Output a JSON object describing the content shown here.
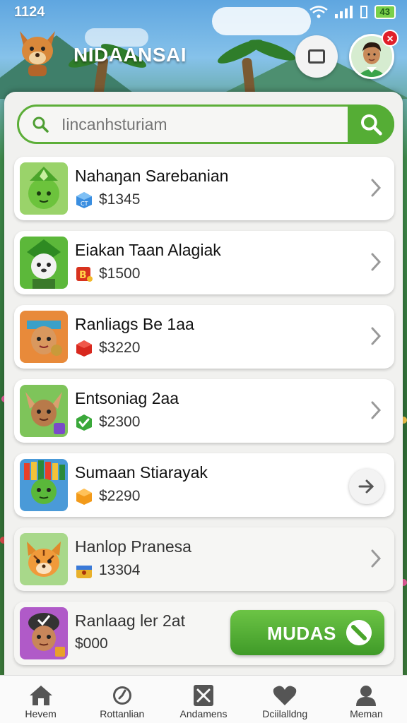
{
  "status_bar": {
    "time": "1124",
    "battery": "43"
  },
  "header": {
    "title": "NIDAANSAI",
    "notification_count": "×"
  },
  "search": {
    "placeholder": "Iincanhsturiam"
  },
  "items": [
    {
      "name": "Nahaŋan Sarebanian",
      "price": "$1345",
      "coin_icon": "blue-cube-icon",
      "action": "chevron"
    },
    {
      "name": "Eiakan Taan Alagiak",
      "price": "$1500",
      "coin_icon": "red-badge-icon",
      "action": "chevron"
    },
    {
      "name": "Ranliags Be 1aa",
      "price": "$3220",
      "coin_icon": "red-cube-icon",
      "action": "chevron"
    },
    {
      "name": "Entsoniag 2aa",
      "price": "$2300",
      "coin_icon": "green-check-icon",
      "action": "chevron"
    },
    {
      "name": "Sumaan Stiarayak",
      "price": "$2290",
      "coin_icon": "orange-cube-icon",
      "action": "arrow"
    },
    {
      "name": "Hanlop Pranesa",
      "price": "13304",
      "coin_icon": "gold-chest-icon",
      "action": "chevron"
    },
    {
      "name": "Ranlaag ler 2at",
      "price": "$000",
      "coin_icon": "none",
      "action": "button",
      "button_label": "MUDAS"
    }
  ],
  "nav": [
    {
      "label": "Hevem",
      "icon": "home-icon"
    },
    {
      "label": "Rottanlian",
      "icon": "clock-icon"
    },
    {
      "label": "Andamens",
      "icon": "tools-icon"
    },
    {
      "label": "Dciilalldng",
      "icon": "heart-icon"
    },
    {
      "label": "Meman",
      "icon": "user-icon"
    }
  ],
  "colors": {
    "accent_green": "#55ad35",
    "badge_red": "#e0202a"
  }
}
